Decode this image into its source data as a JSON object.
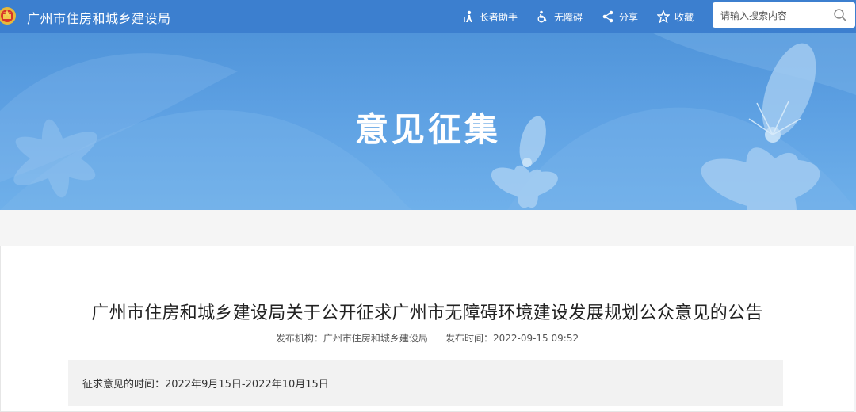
{
  "header": {
    "site_title": "广州市住房和城乡建设局",
    "tools": [
      {
        "label": "长者助手",
        "icon": "elder-assist-icon"
      },
      {
        "label": "无障碍",
        "icon": "wheelchair-icon"
      },
      {
        "label": "分享",
        "icon": "share-icon"
      },
      {
        "label": "收藏",
        "icon": "star-icon"
      }
    ],
    "search": {
      "placeholder": "请输入搜索内容",
      "value": ""
    }
  },
  "banner": {
    "heading": "意见征集"
  },
  "article": {
    "title": "广州市住房和城乡建设局关于公开征求广州市无障碍环境建设发展规划公众意见的公告",
    "publisher_label": "发布机构：",
    "publisher": "广州市住房和城乡建设局",
    "time_label": "发布时间：",
    "time": "2022-09-15 09:52",
    "period_label": "征求意见的时间：",
    "period": "2022年9月15日-2022年10月15日"
  },
  "colors": {
    "topbar": "#3c7fcf",
    "banner": "#5ea1e3",
    "accent": "#ffffff"
  }
}
